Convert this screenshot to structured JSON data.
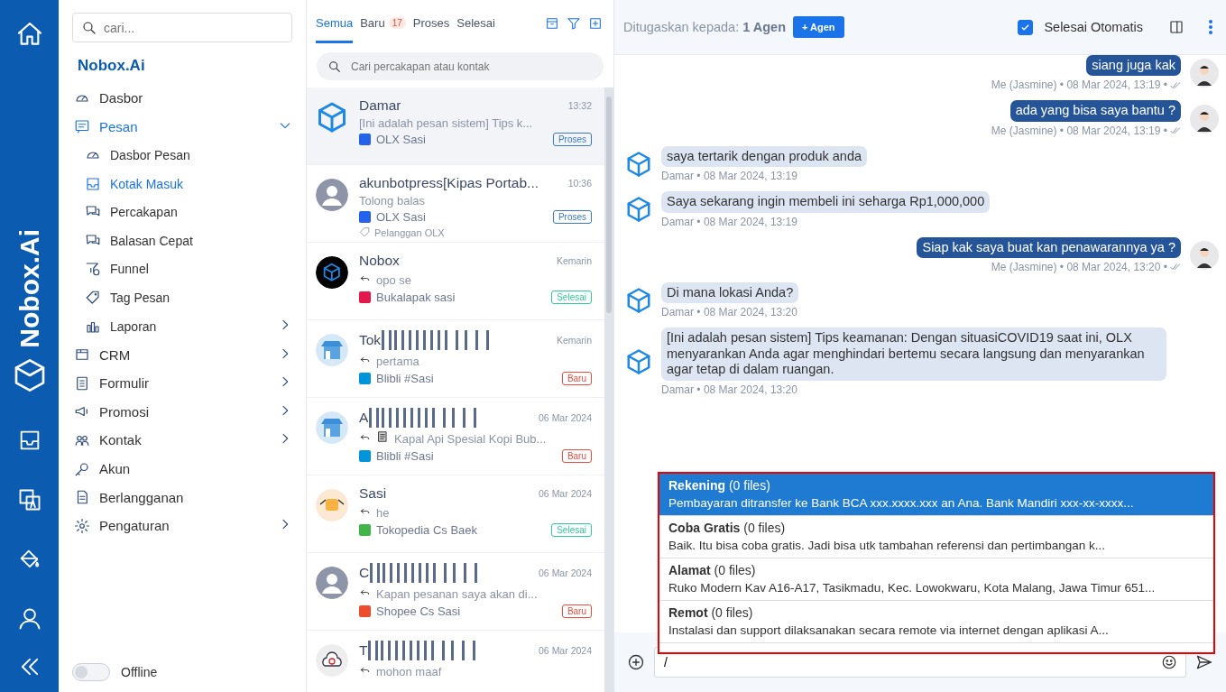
{
  "rail": {
    "brand": "Nobox.Ai"
  },
  "sidebar": {
    "search": {
      "placeholder": "cari..."
    },
    "brand": "Nobox.Ai",
    "items": [
      {
        "label": "Dasbor",
        "kind": "link",
        "selected": false
      },
      {
        "label": "Pesan",
        "kind": "group",
        "selected": true,
        "expanded": true,
        "children": [
          {
            "label": "Dasbor Pesan",
            "kind": "link",
            "selected": false
          },
          {
            "label": "Kotak Masuk",
            "kind": "link",
            "selected": true
          },
          {
            "label": "Percakapan",
            "kind": "link",
            "selected": false
          },
          {
            "label": "Balasan Cepat",
            "kind": "link",
            "selected": false
          },
          {
            "label": "Funnel",
            "kind": "link",
            "selected": false
          },
          {
            "label": "Tag Pesan",
            "kind": "link",
            "selected": false
          },
          {
            "label": "Laporan",
            "kind": "group",
            "selected": false,
            "expanded": false
          }
        ]
      },
      {
        "label": "CRM",
        "kind": "group",
        "selected": false,
        "expanded": false
      },
      {
        "label": "Formulir",
        "kind": "group",
        "selected": false,
        "expanded": false
      },
      {
        "label": "Promosi",
        "kind": "group",
        "selected": false,
        "expanded": false
      },
      {
        "label": "Kontak",
        "kind": "group",
        "selected": false,
        "expanded": false
      },
      {
        "label": "Akun",
        "kind": "link",
        "selected": false
      },
      {
        "label": "Berlangganan",
        "kind": "link",
        "selected": false
      },
      {
        "label": "Pengaturan",
        "kind": "group",
        "selected": false,
        "expanded": false
      }
    ],
    "status": {
      "label": "Offline",
      "on": false
    }
  },
  "inbox": {
    "tabs": [
      {
        "label": "Semua",
        "selected": true
      },
      {
        "label": "Baru",
        "selected": false,
        "badge": "17"
      },
      {
        "label": "Proses",
        "selected": false
      },
      {
        "label": "Selesai",
        "selected": false
      }
    ],
    "search": {
      "placeholder": "Cari percakapan atau kontak"
    },
    "conversations": [
      {
        "name": "Damar",
        "redacted": false,
        "time": "13:32",
        "preview": "[Ini adalah pesan sistem] Tips k...",
        "reply": false,
        "document": false,
        "channel": {
          "name": "OLX Sasi",
          "color": "#2563eb"
        },
        "status": {
          "label": "Proses",
          "color": "#3a78c9"
        },
        "kind": "cube",
        "selected": true
      },
      {
        "name": "akunbotpress[Kipas Portab...",
        "redacted": false,
        "time": "10:36",
        "preview": "Tolong balas",
        "reply": false,
        "document": false,
        "channel": {
          "name": "OLX Sasi",
          "color": "#2563eb"
        },
        "status": {
          "label": "Proses",
          "color": "#3a78c9"
        },
        "tag": "Pelanggan OLX",
        "kind": "person",
        "selected": false
      },
      {
        "name": "Nobox",
        "redacted": false,
        "time": "Kemarin",
        "preview": "opo se",
        "reply": true,
        "document": false,
        "channel": {
          "name": "Bukalapak sasi",
          "color": "#e3194b"
        },
        "status": {
          "label": "Selesai",
          "color": "#2ecc9a"
        },
        "kind": "dark-cube",
        "selected": false
      },
      {
        "name": "Tok",
        "redacted": true,
        "time": "Kemarin",
        "preview": "pertama",
        "reply": true,
        "document": false,
        "channel": {
          "name": "Blibli #Sasi",
          "color": "#0095da"
        },
        "status": {
          "label": "Baru",
          "color": "#e74c3c"
        },
        "kind": "store",
        "selected": false
      },
      {
        "name": "A",
        "redacted": true,
        "time": "06 Mar 2024",
        "preview": "Kapal Api Spesial Kopi Bub...",
        "reply": true,
        "document": true,
        "channel": {
          "name": "Blibli #Sasi",
          "color": "#0095da"
        },
        "status": {
          "label": "Baru",
          "color": "#e74c3c"
        },
        "kind": "store",
        "selected": false
      },
      {
        "name": "Sasi",
        "redacted": false,
        "time": "06 Mar 2024",
        "preview": "he",
        "reply": true,
        "document": false,
        "channel": {
          "name": "Tokopedia Cs Baek",
          "color": "#42b549"
        },
        "status": {
          "label": "Selesai",
          "color": "#2ecc9a"
        },
        "kind": "food",
        "selected": false
      },
      {
        "name": "C",
        "redacted": true,
        "time": "06 Mar 2024",
        "preview": "Kapan pesanan saya akan di...",
        "reply": true,
        "document": false,
        "channel": {
          "name": "Shopee Cs Sasi",
          "color": "#ee4d2d"
        },
        "status": {
          "label": "Baru",
          "color": "#e74c3c"
        },
        "kind": "person",
        "selected": false
      },
      {
        "name": "T",
        "redacted": true,
        "time": "06 Mar 2024",
        "preview": "mohon maaf",
        "reply": true,
        "document": false,
        "kind": "cloud",
        "selected": false
      }
    ]
  },
  "chat": {
    "assigned_label": "Ditugaskan kepada:",
    "assigned_value": "1 Agen",
    "add_agent": "+ Agen",
    "auto_finish": {
      "label": "Selesai Otomatis",
      "checked": true
    },
    "messages": [
      {
        "kind": "out",
        "text": "siang juga kak",
        "meta": "Me (Jasmine) • 08 Mar 2024, 13:19 •",
        "read": true
      },
      {
        "kind": "out",
        "text": "ada yang bisa saya bantu ?",
        "meta": "Me (Jasmine) • 08 Mar 2024, 13:19 •",
        "read": true
      },
      {
        "kind": "in",
        "text": "saya tertarik dengan produk anda",
        "meta": "Damar • 08 Mar 2024, 13:19",
        "read": false
      },
      {
        "kind": "in",
        "text": "Saya sekarang ingin membeli ini seharga Rp1,000,000",
        "meta": "Damar • 08 Mar 2024, 13:19",
        "read": false
      },
      {
        "kind": "out",
        "text": "Siap kak saya buat kan penawarannya ya ?",
        "meta": "Me (Jasmine) • 08 Mar 2024, 13:20 •",
        "read": true
      },
      {
        "kind": "in",
        "text": "Di mana lokasi Anda?",
        "meta": "Damar • 08 Mar 2024, 13:20",
        "read": false
      },
      {
        "kind": "in",
        "text": "[Ini adalah pesan sistem] Tips keamanan: Dengan situasiCOVID19 saat ini, OLX menyarankan Anda agar menghindari bertemu secara langsung dan menyarankan agar tetap di dalam ruangan.",
        "meta": "Damar • 08 Mar 2024, 13:20",
        "read": false
      }
    ],
    "quick_replies": [
      {
        "title": "Rekening",
        "files": "(0 files)",
        "text": "Pembayaran ditransfer ke Bank BCA xxx.xxxx.xxx an Ana. Bank Mandiri xxx-xx-xxxx...",
        "selected": true
      },
      {
        "title": "Coba Gratis",
        "files": "(0 files)",
        "text": "Baik. Itu bisa coba gratis. Jadi bisa utk tambahan referensi dan pertimbangan k...",
        "selected": false
      },
      {
        "title": "Alamat",
        "files": "(0 files)",
        "text": "Ruko Modern Kav A16-A17, Tasikmadu, Kec. Lowokwaru, Kota Malang, Jawa Timur 651...",
        "selected": false
      },
      {
        "title": "Remot",
        "files": "(0 files)",
        "text": "Instalasi dan support dilaksanakan secara remote via internet dengan aplikasi A...",
        "selected": false
      }
    ],
    "composer": {
      "value": "/"
    }
  }
}
